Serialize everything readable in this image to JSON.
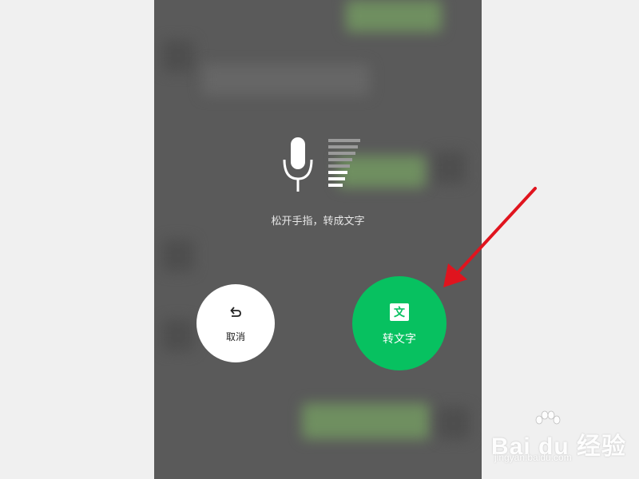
{
  "voice_input": {
    "hint_text": "松开手指，转成文字",
    "level_bars_active": 3,
    "level_bars_total": 8
  },
  "cancel": {
    "label": "取消",
    "icon": "undo-arrow-icon"
  },
  "convert": {
    "label": "转文字",
    "icon_text": "文",
    "color": "#07c160"
  },
  "annotation": {
    "color": "#e0141e"
  },
  "watermark": {
    "brand": "Bai du 经验",
    "url": "jingyan.baidu.com"
  }
}
